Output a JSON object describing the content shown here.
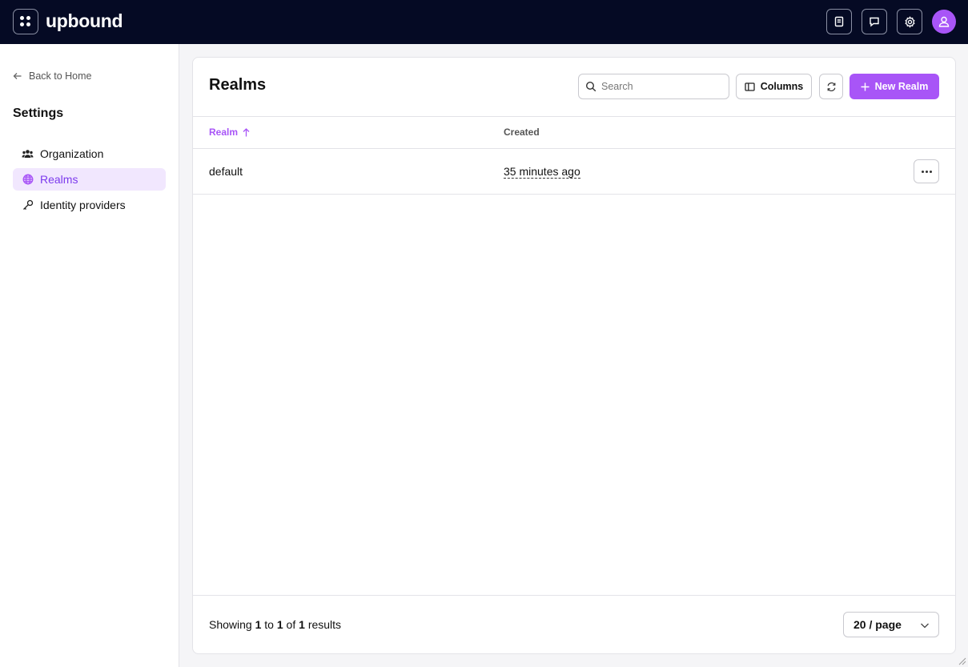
{
  "brand": {
    "name": "upbound",
    "accent": "#a855f7",
    "topbar_bg": "#050a24"
  },
  "topbar": {
    "icons": [
      "apps-grid-icon",
      "docs-icon",
      "chat-icon",
      "gear-icon",
      "user-avatar-icon"
    ]
  },
  "sidebar": {
    "back_label": "Back to Home",
    "title": "Settings",
    "items": [
      {
        "label": "Organization",
        "icon": "people-icon",
        "active": false
      },
      {
        "label": "Realms",
        "icon": "globe-icon",
        "active": true
      },
      {
        "label": "Identity providers",
        "icon": "key-icon",
        "active": false
      }
    ]
  },
  "main": {
    "title": "Realms",
    "search": {
      "placeholder": "Search",
      "value": ""
    },
    "columns_label": "Columns",
    "new_label": "New Realm",
    "table": {
      "headers": [
        "Realm",
        "Created"
      ],
      "sort": {
        "column": "Realm",
        "direction": "ascending"
      },
      "rows": [
        {
          "realm": "default",
          "created": "35 minutes ago"
        }
      ]
    },
    "footer": {
      "showing_label": "Showing",
      "from": "1",
      "to_label": "to",
      "to": "1",
      "of_label": "of",
      "total": "1",
      "results_label": "results",
      "page_size": "20 / page"
    }
  }
}
